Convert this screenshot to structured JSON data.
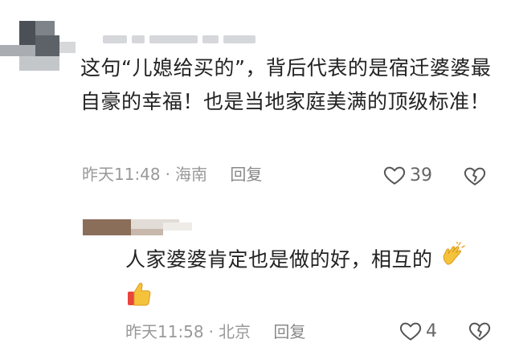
{
  "main_comment": {
    "text": "这句“儿媳给买的”，背后代表的是宿迁婆婆最自豪的幸福！也是当地家庭美满的顶级标准！",
    "time": "昨天11:48",
    "separator": "·",
    "location": "海南",
    "reply_label": "回复",
    "like_count": "39"
  },
  "reply_comment": {
    "text": "人家婆婆肯定也是做的好，相互的",
    "emojis": [
      "clapping-hands",
      "thumbs-up"
    ],
    "time": "昨天11:58",
    "separator": "·",
    "location": "北京",
    "reply_label": "回复",
    "like_count": "4"
  },
  "colors": {
    "text": "#222222",
    "meta": "#999999",
    "icon": "#666666"
  }
}
